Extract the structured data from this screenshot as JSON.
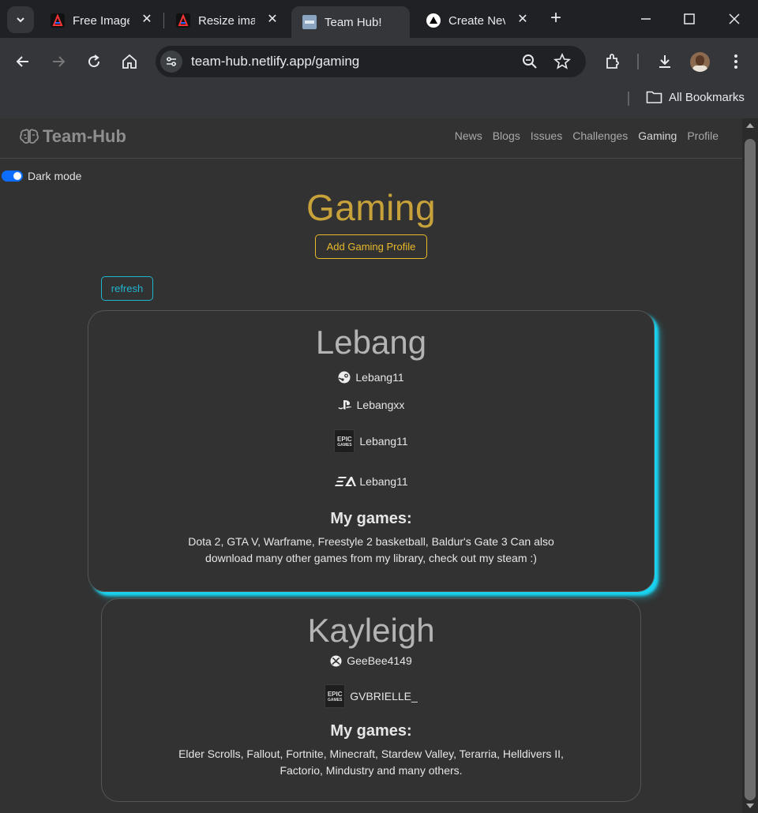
{
  "browser": {
    "tabs": [
      {
        "title": "Free Image",
        "active": false
      },
      {
        "title": "Resize ima",
        "active": false
      },
      {
        "title": "Team Hub!",
        "active": true
      },
      {
        "title": "Create Nev",
        "active": false
      }
    ],
    "url": "team-hub.netlify.app/gaming",
    "bookmarks_label": "All Bookmarks"
  },
  "site": {
    "brand": "Team-Hub",
    "nav": [
      "News",
      "Blogs",
      "Issues",
      "Challenges",
      "Gaming",
      "Profile"
    ],
    "active_nav": "Gaming",
    "dark_mode_label": "Dark mode",
    "dark_mode_on": true
  },
  "page": {
    "title": "Gaming",
    "add_button": "Add Gaming Profile",
    "refresh_button": "refresh"
  },
  "profiles": [
    {
      "name": "Lebang",
      "accounts": [
        {
          "platform": "steam-icon",
          "handle": "Lebang11"
        },
        {
          "platform": "playstation-icon",
          "handle": "Lebangxx"
        },
        {
          "platform": "epic-games-icon",
          "handle": "Lebang11"
        },
        {
          "platform": "ea-icon",
          "handle": "Lebang11"
        }
      ],
      "games_heading": "My games:",
      "games_line1": "Dota 2, GTA V, Warframe, Freestyle 2 basketball, Baldur's Gate 3 Can also",
      "games_line2": "download many other games from my library, check out my steam :)"
    },
    {
      "name": "Kayleigh",
      "accounts": [
        {
          "platform": "xbox-icon",
          "handle": "GeeBee4149"
        },
        {
          "platform": "epic-games-icon",
          "handle": "GVBRIELLE_"
        }
      ],
      "games_heading": "My games:",
      "games_line1": "Elder Scrolls, Fallout, Fortnite, Minecraft, Stardew Valley, Terarria, Helldivers II,",
      "games_line2": "Factorio, Mindustry and many others."
    }
  ],
  "colors": {
    "accent_gold": "#c7a13a",
    "accent_cyan": "#19d3f0",
    "toggle_blue": "#0d6efd"
  },
  "icons": {
    "epic_line1": "EPIC",
    "epic_line2": "GAMES"
  }
}
